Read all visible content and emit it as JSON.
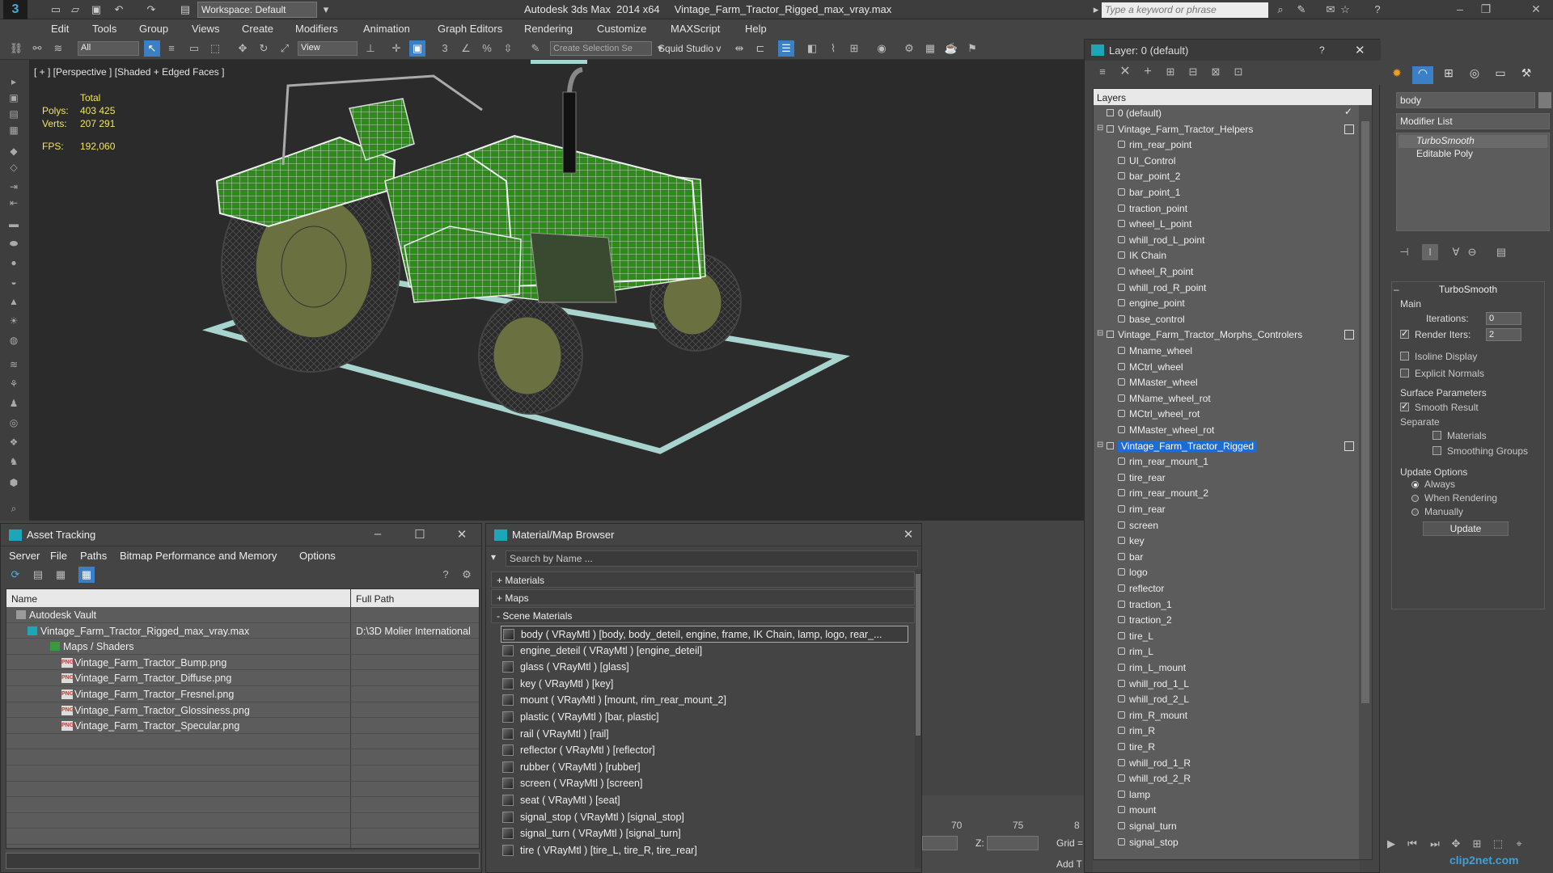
{
  "app": {
    "title": "Autodesk 3ds Max  2014 x64     Vintage_Farm_Tractor_Rigged_max_vray.max",
    "workspace": "Workspace: Default",
    "search_placeholder": "Type a keyword or phrase"
  },
  "menu": [
    "Edit",
    "Tools",
    "Group",
    "Views",
    "Create",
    "Modifiers",
    "Animation",
    "Graph Editors",
    "Rendering",
    "Customize",
    "MAXScript",
    "Help"
  ],
  "toolbar": {
    "filter": "All",
    "ref_coord": "View",
    "selection_set": "Create Selection Se",
    "squid": "Squid Studio v"
  },
  "viewport": {
    "label": "[ + ] [Perspective ] [Shaded + Edged Faces ]",
    "stats_total_label": "Total",
    "polys_label": "Polys:",
    "polys_value": "403 425",
    "verts_label": "Verts:",
    "verts_value": "207 291",
    "fps_label": "FPS:",
    "fps_value": "192,060"
  },
  "layer_panel": {
    "title": "Layer: 0 (default)",
    "help": "?",
    "header": "Layers",
    "rows": [
      {
        "name": "0 (default)",
        "level": 0,
        "type": "layer"
      },
      {
        "name": "Vintage_Farm_Tractor_Helpers",
        "level": 0,
        "type": "layer"
      },
      {
        "name": "rim_rear_point",
        "level": 1,
        "type": "obj"
      },
      {
        "name": "UI_Control",
        "level": 1,
        "type": "obj"
      },
      {
        "name": "bar_point_2",
        "level": 1,
        "type": "obj"
      },
      {
        "name": "bar_point_1",
        "level": 1,
        "type": "obj"
      },
      {
        "name": "traction_point",
        "level": 1,
        "type": "obj"
      },
      {
        "name": "wheel_L_point",
        "level": 1,
        "type": "obj"
      },
      {
        "name": "whill_rod_L_point",
        "level": 1,
        "type": "obj"
      },
      {
        "name": "IK Chain",
        "level": 1,
        "type": "obj"
      },
      {
        "name": "wheel_R_point",
        "level": 1,
        "type": "obj"
      },
      {
        "name": "whill_rod_R_point",
        "level": 1,
        "type": "obj"
      },
      {
        "name": "engine_point",
        "level": 1,
        "type": "obj"
      },
      {
        "name": "base_control",
        "level": 1,
        "type": "obj"
      },
      {
        "name": "Vintage_Farm_Tractor_Morphs_Controlers",
        "level": 0,
        "type": "layer"
      },
      {
        "name": "Mname_wheel",
        "level": 1,
        "type": "obj"
      },
      {
        "name": "MCtrl_wheel",
        "level": 1,
        "type": "obj"
      },
      {
        "name": "MMaster_wheel",
        "level": 1,
        "type": "obj"
      },
      {
        "name": "MName_wheel_rot",
        "level": 1,
        "type": "obj"
      },
      {
        "name": "MCtrl_wheel_rot",
        "level": 1,
        "type": "obj"
      },
      {
        "name": "MMaster_wheel_rot",
        "level": 1,
        "type": "obj"
      },
      {
        "name": "Vintage_Farm_Tractor_Rigged",
        "level": 0,
        "type": "layer",
        "selected": true
      },
      {
        "name": "rim_rear_mount_1",
        "level": 1,
        "type": "obj"
      },
      {
        "name": "tire_rear",
        "level": 1,
        "type": "obj"
      },
      {
        "name": "rim_rear_mount_2",
        "level": 1,
        "type": "obj"
      },
      {
        "name": "rim_rear",
        "level": 1,
        "type": "obj"
      },
      {
        "name": "screen",
        "level": 1,
        "type": "obj"
      },
      {
        "name": "key",
        "level": 1,
        "type": "obj"
      },
      {
        "name": "bar",
        "level": 1,
        "type": "obj"
      },
      {
        "name": "logo",
        "level": 1,
        "type": "obj"
      },
      {
        "name": "reflector",
        "level": 1,
        "type": "obj"
      },
      {
        "name": "traction_1",
        "level": 1,
        "type": "obj"
      },
      {
        "name": "traction_2",
        "level": 1,
        "type": "obj"
      },
      {
        "name": "tire_L",
        "level": 1,
        "type": "obj"
      },
      {
        "name": "rim_L",
        "level": 1,
        "type": "obj"
      },
      {
        "name": "rim_L_mount",
        "level": 1,
        "type": "obj"
      },
      {
        "name": "whill_rod_1_L",
        "level": 1,
        "type": "obj"
      },
      {
        "name": "whill_rod_2_L",
        "level": 1,
        "type": "obj"
      },
      {
        "name": "rim_R_mount",
        "level": 1,
        "type": "obj"
      },
      {
        "name": "rim_R",
        "level": 1,
        "type": "obj"
      },
      {
        "name": "tire_R",
        "level": 1,
        "type": "obj"
      },
      {
        "name": "whill_rod_1_R",
        "level": 1,
        "type": "obj"
      },
      {
        "name": "whill_rod_2_R",
        "level": 1,
        "type": "obj"
      },
      {
        "name": "lamp",
        "level": 1,
        "type": "obj"
      },
      {
        "name": "mount",
        "level": 1,
        "type": "obj"
      },
      {
        "name": "signal_turn",
        "level": 1,
        "type": "obj"
      },
      {
        "name": "signal_stop",
        "level": 1,
        "type": "obj"
      }
    ]
  },
  "command_panel": {
    "object_name": "body",
    "modifier_list": "Modifier List",
    "stack": [
      "TurboSmooth",
      "Editable Poly"
    ],
    "turbosmooth": {
      "title": "TurboSmooth",
      "main": "Main",
      "iterations_label": "Iterations:",
      "iterations_value": "0",
      "render_iters_label": "Render Iters:",
      "render_iters_value": "2",
      "isoline": "Isoline Display",
      "explicit": "Explicit Normals",
      "surface_params": "Surface Parameters",
      "smooth_result": "Smooth Result",
      "separate": "Separate",
      "materials": "Materials",
      "smoothing_groups": "Smoothing Groups",
      "update_options": "Update Options",
      "always": "Always",
      "when_rendering": "When Rendering",
      "manually": "Manually",
      "update_button": "Update"
    }
  },
  "asset_tracking": {
    "title": "Asset Tracking",
    "menu": [
      "Server",
      "File",
      "Paths",
      "Bitmap Performance and Memory",
      "Options"
    ],
    "col_name": "Name",
    "col_path": "Full Path",
    "rows": [
      {
        "name": "Autodesk Vault",
        "path": "",
        "indent": 1
      },
      {
        "name": "Vintage_Farm_Tractor_Rigged_max_vray.max",
        "path": "D:\\3D Molier International",
        "indent": 2
      },
      {
        "name": "Maps / Shaders",
        "path": "",
        "indent": 3
      },
      {
        "name": "Vintage_Farm_Tractor_Bump.png",
        "path": "",
        "indent": 4
      },
      {
        "name": "Vintage_Farm_Tractor_Diffuse.png",
        "path": "",
        "indent": 4
      },
      {
        "name": "Vintage_Farm_Tractor_Fresnel.png",
        "path": "",
        "indent": 4
      },
      {
        "name": "Vintage_Farm_Tractor_Glossiness.png",
        "path": "",
        "indent": 4
      },
      {
        "name": "Vintage_Farm_Tractor_Specular.png",
        "path": "",
        "indent": 4
      }
    ]
  },
  "material_browser": {
    "title": "Material/Map Browser",
    "search_placeholder": "Search by Name ...",
    "groups": [
      "+ Materials",
      "+ Maps",
      "- Scene Materials"
    ],
    "materials": [
      "body  ( VRayMtl ) [body, body_deteil, engine, frame, IK Chain, lamp, logo, rear_...",
      "engine_deteil  ( VRayMtl ) [engine_deteil]",
      "glass  ( VRayMtl ) [glass]",
      "key  ( VRayMtl ) [key]",
      "mount  ( VRayMtl ) [mount, rim_rear_mount_2]",
      "plastic  ( VRayMtl ) [bar, plastic]",
      "rail  ( VRayMtl ) [rail]",
      "reflector  ( VRayMtl ) [reflector]",
      "rubber  ( VRayMtl ) [rubber]",
      "screen  ( VRayMtl ) [screen]",
      "seat  ( VRayMtl ) [seat]",
      "signal_stop  ( VRayMtl ) [signal_stop]",
      "signal_turn  ( VRayMtl ) [signal_turn]",
      "tire  ( VRayMtl ) [tire_L, tire_R, tire_rear]"
    ]
  },
  "timeline": {
    "ticks": [
      "70",
      "75",
      "8"
    ],
    "z_label": "Z:",
    "grid_label": "Grid =",
    "add_label": "Add T"
  },
  "watermark": "clip2net.com",
  "colors": {
    "accent_select": "#1e6bd6",
    "viewport_bg": "#2b2b2b",
    "wire_green": "#2f8a1c",
    "stats_yellow": "#f2e45c"
  }
}
